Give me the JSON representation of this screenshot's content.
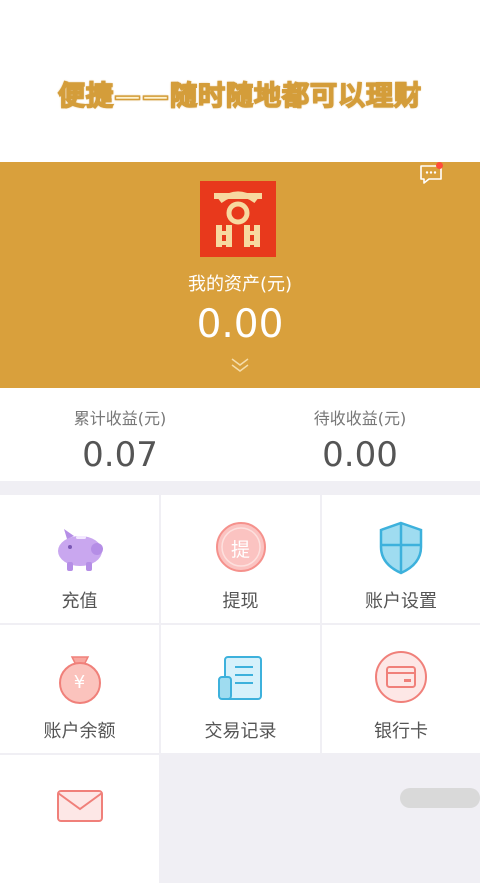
{
  "banner": {
    "slogan": "便捷——随时随地都可以理财"
  },
  "hero": {
    "assets_label": "我的资产(元)",
    "assets_value": "0.00",
    "accent": "#d9a03c"
  },
  "stats": [
    {
      "label": "累计收益(元)",
      "value": "0.07"
    },
    {
      "label": "待收收益(元)",
      "value": "0.00"
    }
  ],
  "menu": [
    {
      "label": "充值",
      "icon": "piggy-bank-icon"
    },
    {
      "label": "提现",
      "icon": "withdraw-icon",
      "glyph": "提"
    },
    {
      "label": "账户设置",
      "icon": "shield-icon"
    },
    {
      "label": "账户余额",
      "icon": "money-bag-icon",
      "glyph": "¥"
    },
    {
      "label": "交易记录",
      "icon": "scroll-icon"
    },
    {
      "label": "银行卡",
      "icon": "bank-card-icon"
    },
    {
      "label": "",
      "icon": "envelope-icon"
    }
  ]
}
